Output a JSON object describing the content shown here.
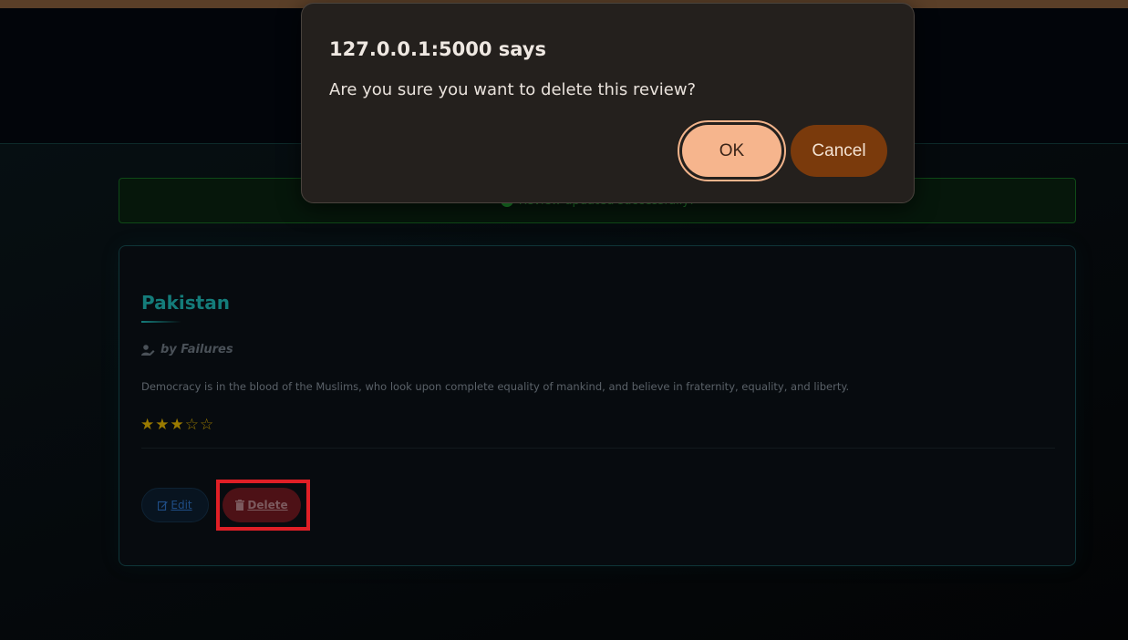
{
  "alert": {
    "message": "Review updated successfully!"
  },
  "review": {
    "title": "Pakistan",
    "author": "by Failures",
    "text": "Democracy is in the blood of the Muslims, who look upon complete equality of mankind, and believe in fraternity, equality, and liberty.",
    "rating": 3,
    "max_rating": 5,
    "edit_label": "Edit",
    "delete_label": "Delete"
  },
  "dialog": {
    "title": "127.0.0.1:5000 says",
    "message": "Are you sure you want to delete this review?",
    "ok_label": "OK",
    "cancel_label": "Cancel"
  },
  "colors": {
    "accent": "#147c7a",
    "star": "#9a7a00",
    "ok_button": "#f6b58d",
    "cancel_button": "#7a3a0c",
    "highlight": "#e01f26"
  }
}
